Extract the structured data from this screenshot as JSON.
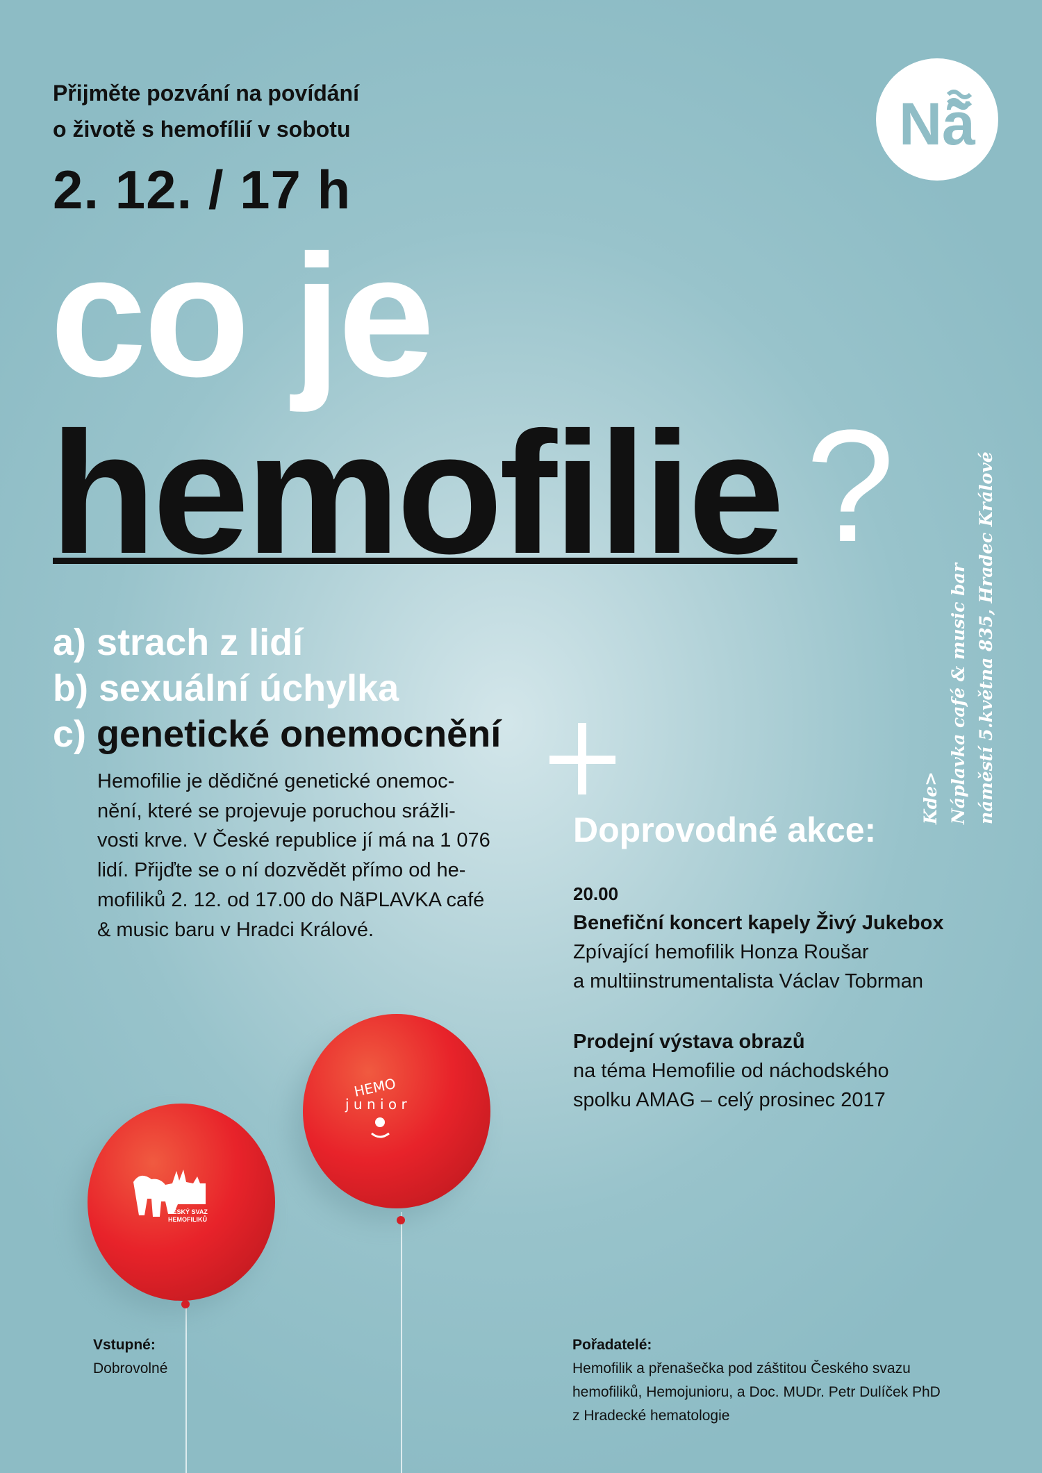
{
  "intro": {
    "line1": "Přijměte pozvání na povídání",
    "line2": "o životě s hemofílií v sobotu",
    "date": "2. 12. / 17 h"
  },
  "headline": {
    "line1": "co je",
    "line2": "hemofilie",
    "qmark": "?"
  },
  "options": [
    {
      "prefix": "a)",
      "text": "strach z lidí"
    },
    {
      "prefix": "b)",
      "text": "sexuální úchylka"
    },
    {
      "prefix": "c)",
      "text": "genetické onemocnění"
    }
  ],
  "description": [
    "Hemofilie je dědičné genetické onemoc-",
    "nění, které se projevuje poruchou srážli-",
    "vosti krve. V České republice jí má na 1 076",
    "lidí. Přijďte se o ní dozvědět přímo od he-",
    "mofiliků 2. 12. od 17.00 do NãPLAVKA café",
    "& music baru v Hradci Králové."
  ],
  "events": {
    "title": "Doprovodné akce:",
    "concert": {
      "time": "20.00",
      "title": "Benefiční koncert kapely Živý Jukebox",
      "line1": "Zpívající hemofilik Honza Roušar",
      "line2": "a multiinstrumentalista Václav Tobrman"
    },
    "exhibition": {
      "title": "Prodejní výstava obrazů",
      "line1": "na téma Hemofilie od náchodského",
      "line2": "spolku AMAG – celý prosinec 2017"
    }
  },
  "venue": {
    "label": "Kde>",
    "name": "Náplavka café & music bar",
    "address": "náměstí 5.května 835, Hradec Králové"
  },
  "logo": {
    "text": "Nã",
    "color": "#8fbdc6"
  },
  "balloons": {
    "left_logo": {
      "line1": "ČESKÝ SVAZ",
      "line2": "HEMOFILIKŮ"
    },
    "right_logo": {
      "top": "HEMO",
      "bottom": "j u n i o r"
    },
    "color": "#e8232a"
  },
  "admission": {
    "label": "Vstupné:",
    "value": "Dobrovolné"
  },
  "organizers": {
    "label": "Pořadatelé:",
    "lines": [
      "Hemofilik a přenašečka pod záštitou Českého svazu",
      "hemofiliků, Hemojunioru, a Doc. MUDr. Petr Dulíček PhD",
      "z Hradecké hematologie"
    ]
  }
}
